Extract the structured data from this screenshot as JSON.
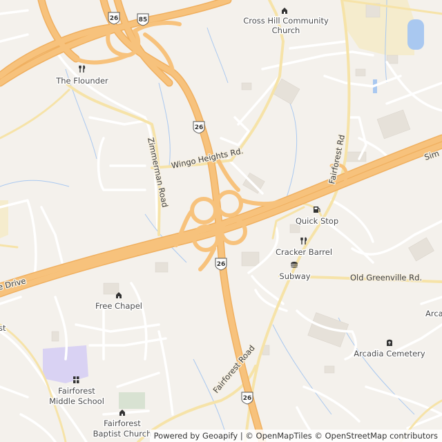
{
  "map": {
    "colors": {
      "background": "#f4f1ec",
      "highway": "#f7c27c",
      "highway_casing": "#f0b060",
      "minor_road": "#ffffff",
      "building": "#e6e1d9",
      "water": "#a9c8f0",
      "stream": "#a9c8f0",
      "school": "#d9d2f3",
      "industrial": "#f5eccd",
      "park": "#d8e2d2"
    },
    "roads": {
      "zimmerman": "Zimmerman Road",
      "wingo": "Wingo Heights Rd.",
      "fairforest_north": "Fairforest Rd",
      "fairforest_south": "Fairforest Road",
      "old_greenville": "Old Greenville Rd.",
      "drive_left": "e Drive",
      "sim_right": "Sim"
    },
    "shields": {
      "i26_top": "26",
      "i85_top": "85",
      "i26_mid": "26",
      "i26_interchange": "26",
      "i26_bottom": "26"
    },
    "pois": {
      "cross_hill_1": "Cross Hill Community",
      "cross_hill_2": "Church",
      "flounder": "The Flounder",
      "quick_stop": "Quick Stop",
      "cracker_barrel": "Cracker Barrel",
      "subway": "Subway",
      "free_chapel": "Free Chapel",
      "arcadia_cemetery": "Arcadia Cemetery",
      "arca": "Arca",
      "fairforest_ms_1": "Fairforest",
      "fairforest_ms_2": "Middle School",
      "fairforest_bc_1": "Fairforest",
      "fairforest_bc_2": "Baptist Church",
      "st": "st"
    }
  },
  "attribution": {
    "powered_by": "Powered by",
    "geoapify": "Geoapify",
    "sep1": "|",
    "omt": "© OpenMapTiles",
    "osm": "© OpenStreetMap",
    "contributors": "contributors"
  }
}
